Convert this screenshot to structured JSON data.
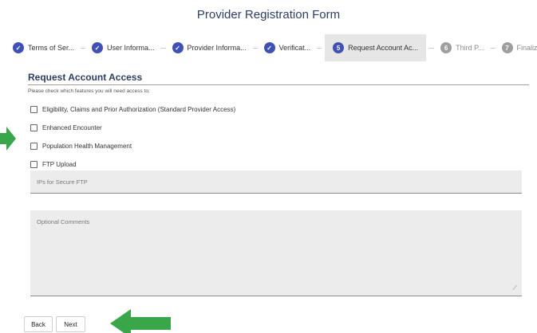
{
  "header": {
    "title": "Provider Registration Form"
  },
  "stepper": {
    "steps": [
      {
        "label": "Terms of Ser...",
        "marker": "✓",
        "state": "done"
      },
      {
        "label": "User Informa...",
        "marker": "✓",
        "state": "done"
      },
      {
        "label": "Provider Informa...",
        "marker": "✓",
        "state": "done"
      },
      {
        "label": "Verificat...",
        "marker": "✓",
        "state": "done"
      },
      {
        "label": "Request Account Ac...",
        "marker": "5",
        "state": "current"
      },
      {
        "label": "Third P...",
        "marker": "6",
        "state": "todo"
      },
      {
        "label": "Finalize",
        "marker": "7",
        "state": "todo"
      }
    ]
  },
  "section": {
    "title": "Request Account Access",
    "instructions": "Please check which features you will need access to:"
  },
  "features": [
    {
      "label": "Eligibility, Claims and Prior Authorization (Standard Provider Access)",
      "checked": false
    },
    {
      "label": "Enhanced Encounter",
      "checked": false
    },
    {
      "label": "Population Health Management",
      "checked": false
    },
    {
      "label": "FTP Upload",
      "checked": false
    }
  ],
  "ftp_ips": {
    "label": "IPs for Secure FTP",
    "value": ""
  },
  "comments": {
    "label": "Optional Comments",
    "value": ""
  },
  "buttons": {
    "back": "Back",
    "next": "Next"
  },
  "colors": {
    "accent": "#3f51b5",
    "title": "#2d3e63",
    "arrow": "#3aa64a"
  }
}
